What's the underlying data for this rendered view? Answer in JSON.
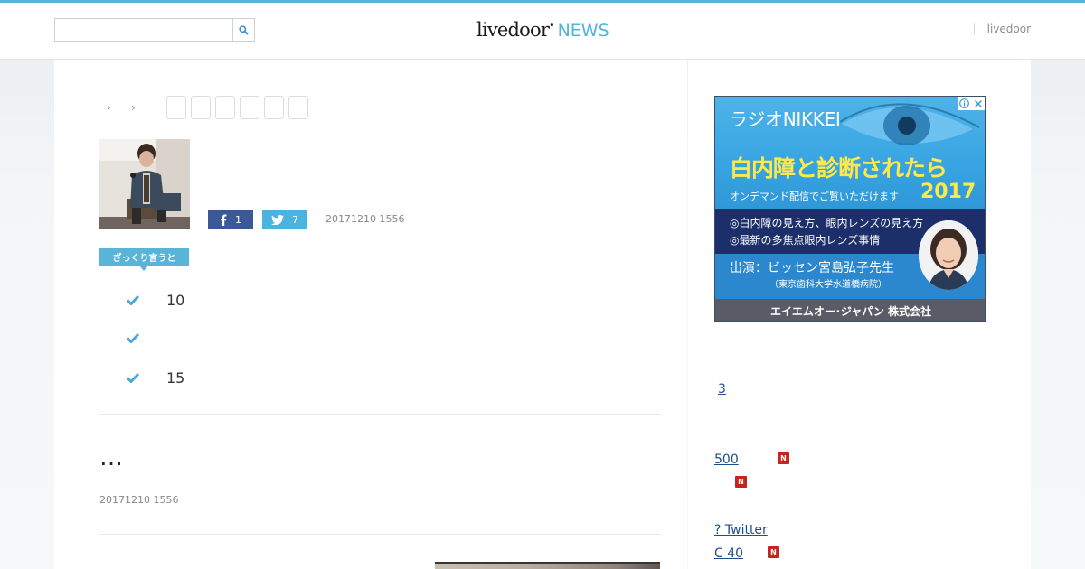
{
  "header": {
    "search": {
      "value": "",
      "placeholder": ""
    },
    "logo": {
      "brand": "livedoor",
      "section": "NEWS"
    },
    "right_link": "livedoor"
  },
  "article": {
    "share": {
      "facebook_count": "1",
      "twitter_count": "7"
    },
    "published": "20171210 1556",
    "summary_label": "ざっくり言うと",
    "summary_points": [
      "10",
      "",
      "15"
    ],
    "body_heading": "…",
    "body_date": "20171210 1556"
  },
  "ad": {
    "line1": "ラジオNIKKEI",
    "headline": "白内障と診断されたら",
    "subline": "オンデマンド配信でご覧いただけます",
    "year": "2017",
    "bullet1": "◎白内障の見え方、眼内レンズの見え方",
    "bullet2": "◎最新の多焦点眼内レンズ事情",
    "guest": "出演：ビッセン宮島弘子先生",
    "guest_affiliation": "（東京歯科大学水道橋病院）",
    "company": "エイエムオー･ジャパン 株式会社"
  },
  "sidebar": {
    "links": [
      {
        "text": "3",
        "new": false
      },
      {
        "text": "500",
        "new": true
      },
      {
        "text": "",
        "new": true
      },
      {
        "text": "? Twitter",
        "new": false
      },
      {
        "text": "C 40",
        "new": true
      }
    ],
    "new_badge": "N"
  },
  "colors": {
    "accent": "#5bb3d9",
    "facebook": "#3b5998",
    "twitter": "#4ab3e0",
    "link": "#1d4e89",
    "new_badge": "#c9231b"
  }
}
